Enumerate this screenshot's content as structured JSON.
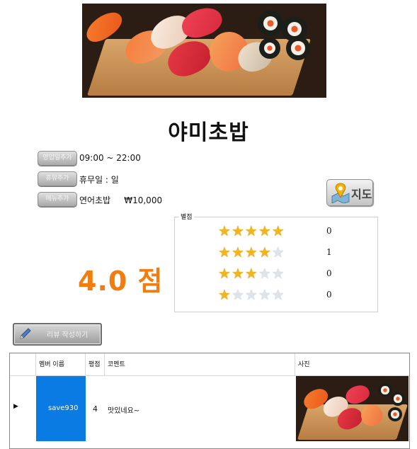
{
  "restaurant": {
    "name": "야미초밥",
    "score_text": "4.0 점"
  },
  "details": {
    "hours_tag": "영업일추가",
    "hours_value": "09:00 ~ 22:00",
    "holiday_tag": "휴뮤추가",
    "holiday_value": "휴무일 : 일",
    "menu_tag": "메뉴추가",
    "menu_value": "연어초밥     ₩10,000"
  },
  "map_button": {
    "label": "지도",
    "icon": "map-pin-icon"
  },
  "rating": {
    "legend": "별점",
    "rows": [
      {
        "stars": 5,
        "count": "0"
      },
      {
        "stars": 4,
        "count": "1"
      },
      {
        "stars": 3,
        "count": "0"
      },
      {
        "stars": 1,
        "count": "0"
      }
    ],
    "colors": {
      "star_full": "#f2b51b",
      "star_empty": "#dfe4ea",
      "score": "#f07d12"
    }
  },
  "review_button": {
    "label": "리뷰 작성하기",
    "icon": "pencil-icon"
  },
  "review_table": {
    "columns": [
      "멤버 이름",
      "평점",
      "코멘트",
      "사진"
    ],
    "rows": [
      {
        "member": "save930",
        "rating": "4",
        "comment": "맛있네요~"
      }
    ],
    "selected_color": "#0a7be2"
  }
}
